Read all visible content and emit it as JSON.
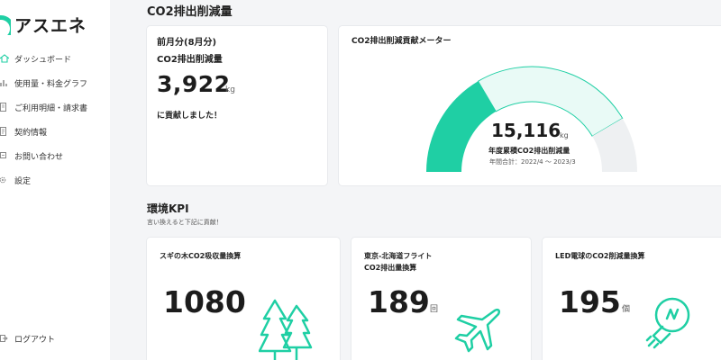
{
  "brand": {
    "name": "アスエネ",
    "color": "#1fcfa4"
  },
  "sidebar": {
    "items": [
      {
        "label": "ダッシュボード",
        "icon": "home-icon",
        "active": true
      },
      {
        "label": "使用量・料金グラフ",
        "icon": "bar-chart-icon"
      },
      {
        "label": "ご利用明細・請求書",
        "icon": "document-icon"
      },
      {
        "label": "契約情報",
        "icon": "contract-icon"
      },
      {
        "label": "お問い合わせ",
        "icon": "chat-icon"
      },
      {
        "label": "設定",
        "icon": "gear-icon"
      }
    ],
    "logout": {
      "label": "ログアウト",
      "icon": "logout-icon"
    }
  },
  "page": {
    "title": "CO2排出削減量"
  },
  "monthly_card": {
    "period": "前月分(8月分)",
    "label": "CO2排出削減量",
    "value": "3,922",
    "unit": "kg",
    "message": "に貢献しました！"
  },
  "meter_card": {
    "title": "CO2排出削減貢献メーター",
    "value": "15,116",
    "unit": "kg",
    "caption": "年度累積CO2排出削減量",
    "period": "年間合計：2022/4 ～ 2023/3",
    "segments": [
      {
        "fraction": 0.33,
        "color": "#1fcfa4"
      },
      {
        "fraction": 0.5,
        "color": "#e9faf6"
      },
      {
        "fraction": 0.17,
        "color": "#eef0f2"
      }
    ]
  },
  "kpi_section": {
    "title": "環境KPI",
    "subtitle": "言い換えると下記に貢献！",
    "cards": [
      {
        "title": "スギの木CO2吸収量換算",
        "value": "1080",
        "unit": "",
        "icon": "trees-icon"
      },
      {
        "title": "東京-北海道フライト\nCO2排出量換算",
        "value": "189",
        "unit": "回",
        "icon": "airplane-icon"
      },
      {
        "title": "LED電球のCO2削減量換算",
        "value": "195",
        "unit": "個",
        "icon": "lightbulb-icon"
      }
    ]
  }
}
